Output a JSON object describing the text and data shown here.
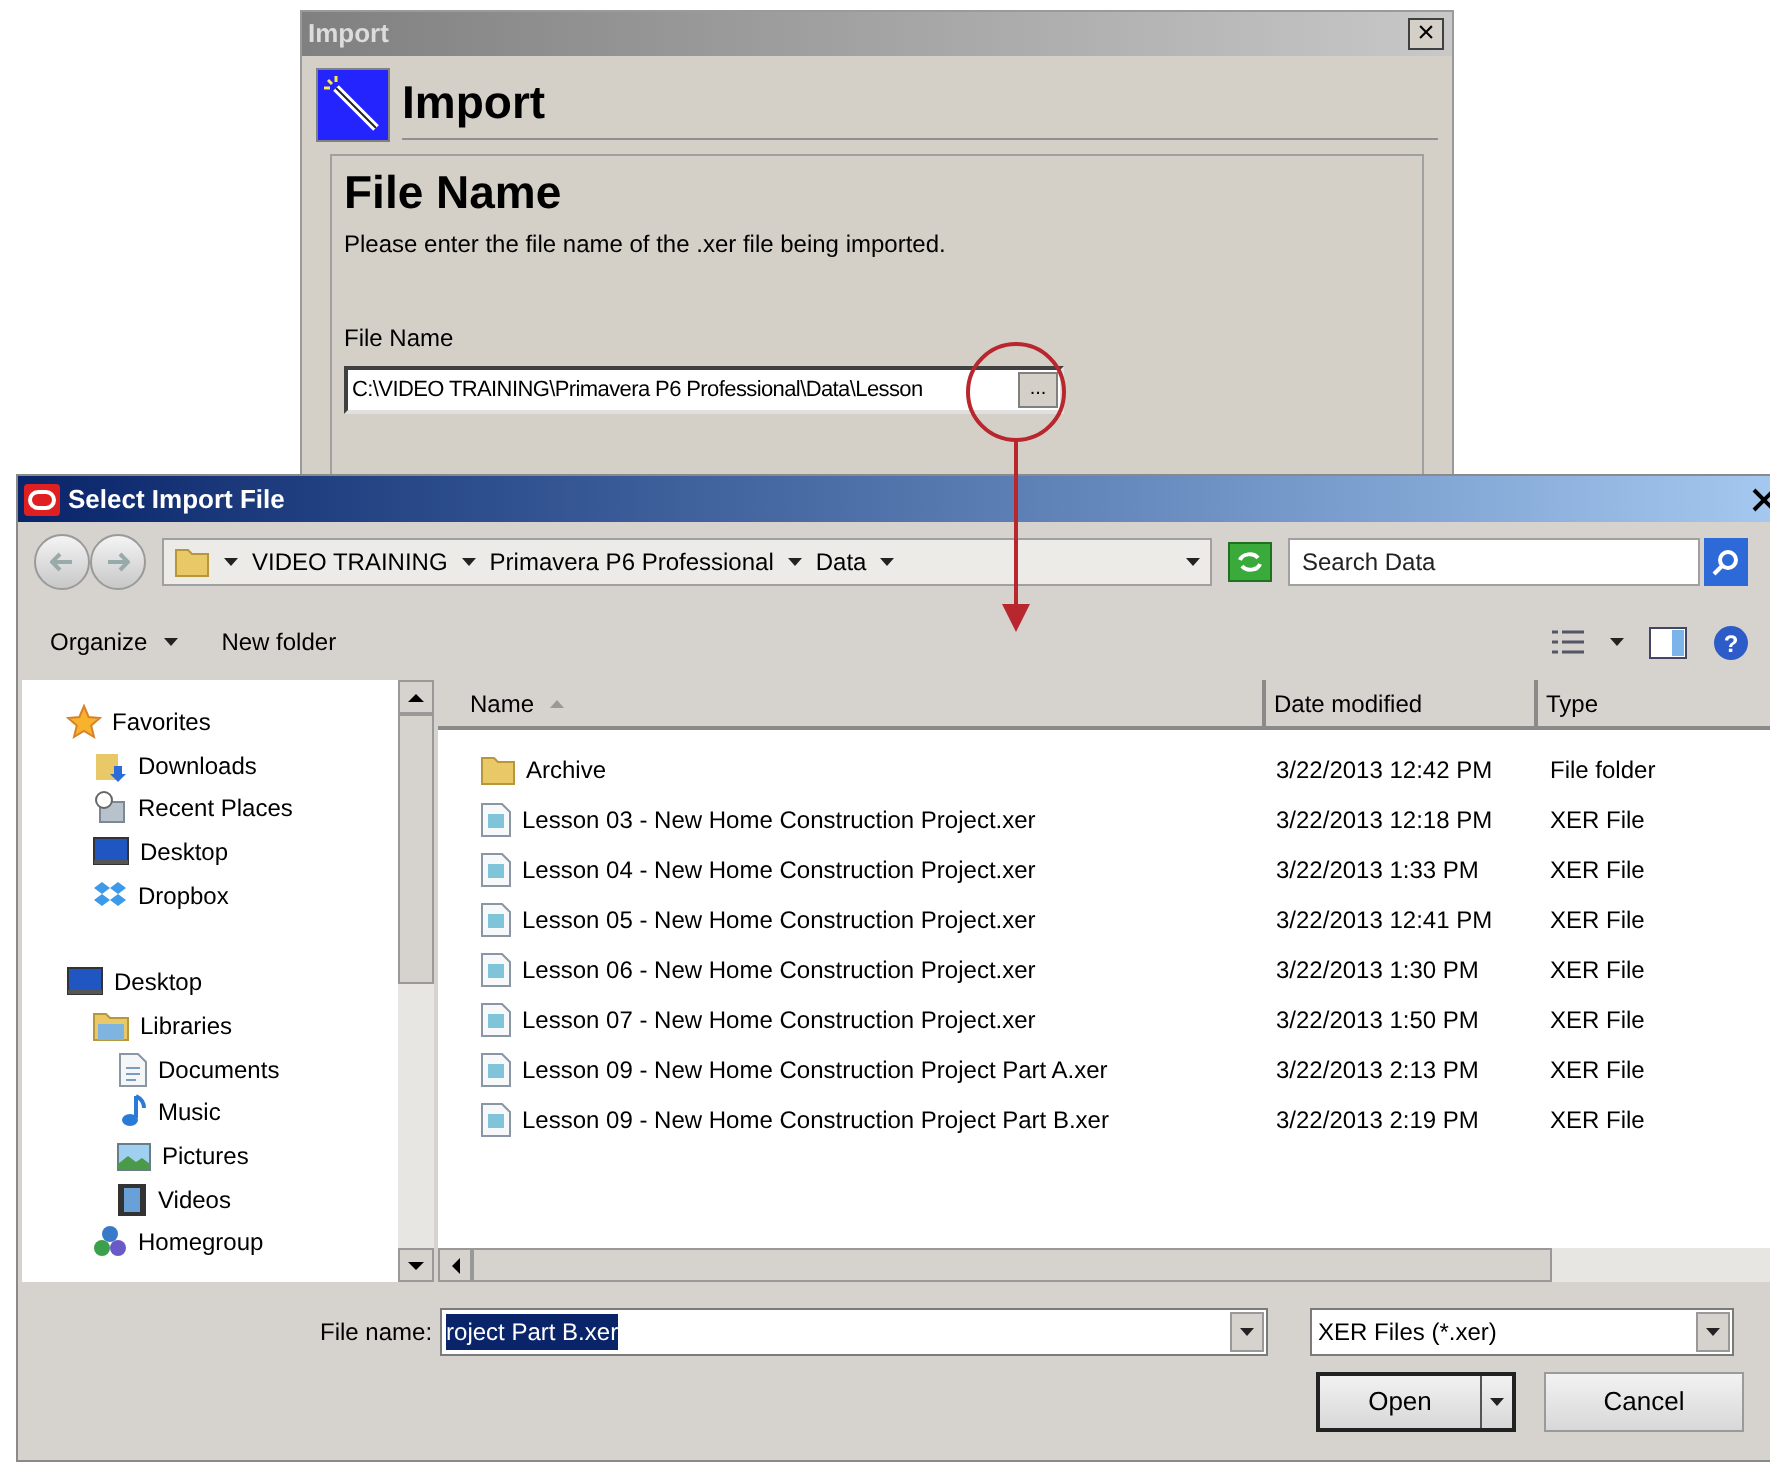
{
  "import_window": {
    "title": "Import",
    "close": "×",
    "heading": "Import",
    "section_title": "File Name",
    "description": "Please enter the file name of the .xer file being imported.",
    "field_label": "File Name",
    "field_value": "C:\\VIDEO TRAINING\\Primavera P6 Professional\\Data\\Lesson",
    "browse_button": "..."
  },
  "file_dialog": {
    "title": "Select Import File",
    "breadcrumbs": [
      "VIDEO TRAINING",
      "Primavera P6 Professional",
      "Data"
    ],
    "search": {
      "placeholder": "Search Data"
    },
    "toolbar": {
      "organize": "Organize",
      "new_folder": "New folder",
      "help": "?"
    },
    "sidebar": [
      {
        "label": "Favorites",
        "kind": "star",
        "children": [
          {
            "label": "Downloads",
            "kind": "downloads"
          },
          {
            "label": "Recent Places",
            "kind": "recent"
          },
          {
            "label": "Desktop",
            "kind": "desktop"
          },
          {
            "label": "Dropbox",
            "kind": "dropbox"
          }
        ]
      },
      {
        "label": "Desktop",
        "kind": "desktop",
        "children": [
          {
            "label": "Libraries",
            "kind": "libraries",
            "children": [
              {
                "label": "Documents",
                "kind": "documents"
              },
              {
                "label": "Music",
                "kind": "music"
              },
              {
                "label": "Pictures",
                "kind": "pictures"
              },
              {
                "label": "Videos",
                "kind": "videos"
              }
            ]
          },
          {
            "label": "Homegroup",
            "kind": "homegroup"
          }
        ]
      }
    ],
    "columns": [
      {
        "label": "Name",
        "sorted": true
      },
      {
        "label": "Date modified",
        "sorted": false
      },
      {
        "label": "Type",
        "sorted": false
      }
    ],
    "files": [
      {
        "name": "Archive",
        "kind": "folder",
        "date": "3/22/2013 12:42 PM",
        "type": "File folder"
      },
      {
        "name": "Lesson 03 - New Home Construction Project.xer",
        "kind": "file",
        "date": "3/22/2013 12:18 PM",
        "type": "XER File"
      },
      {
        "name": "Lesson 04 - New Home Construction Project.xer",
        "kind": "file",
        "date": "3/22/2013 1:33 PM",
        "type": "XER File"
      },
      {
        "name": "Lesson 05 - New Home Construction Project.xer",
        "kind": "file",
        "date": "3/22/2013 12:41 PM",
        "type": "XER File"
      },
      {
        "name": "Lesson 06 - New Home Construction Project.xer",
        "kind": "file",
        "date": "3/22/2013 1:30 PM",
        "type": "XER File"
      },
      {
        "name": "Lesson 07 - New Home Construction Project.xer",
        "kind": "file",
        "date": "3/22/2013 1:50 PM",
        "type": "XER File"
      },
      {
        "name": "Lesson 09 - New Home Construction Project Part A.xer",
        "kind": "file",
        "date": "3/22/2013 2:13 PM",
        "type": "XER File"
      },
      {
        "name": "Lesson 09 - New Home Construction Project Part B.xer",
        "kind": "file",
        "date": "3/22/2013 2:19 PM",
        "type": "XER File"
      }
    ],
    "file_name_label": "File name:",
    "file_name": {
      "value": "roject Part B.xer",
      "highlighted": true
    },
    "filter": "XER Files (*.xer)",
    "buttons": [
      "Open",
      "Cancel"
    ]
  }
}
